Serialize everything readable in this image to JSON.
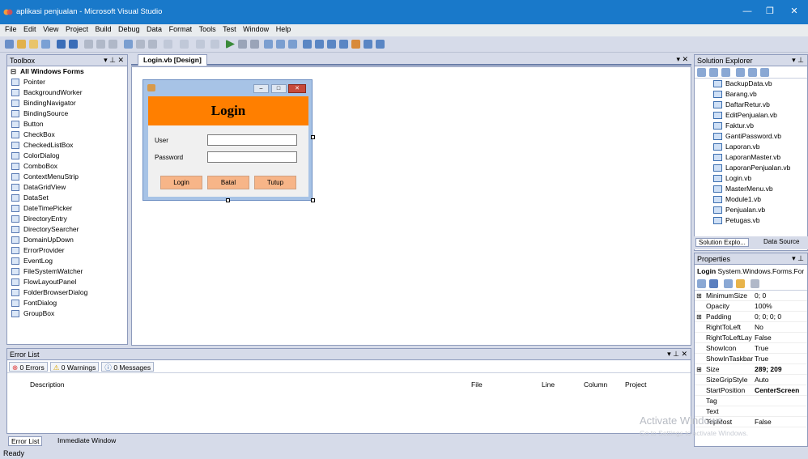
{
  "window": {
    "title": "aplikasi penjualan - Microsoft Visual Studio"
  },
  "menu": [
    "File",
    "Edit",
    "View",
    "Project",
    "Build",
    "Debug",
    "Data",
    "Format",
    "Tools",
    "Test",
    "Window",
    "Help"
  ],
  "toolbox": {
    "title": "Toolbox",
    "category": "All Windows Forms",
    "items": [
      "Pointer",
      "BackgroundWorker",
      "BindingNavigator",
      "BindingSource",
      "Button",
      "CheckBox",
      "CheckedListBox",
      "ColorDialog",
      "ComboBox",
      "ContextMenuStrip",
      "DataGridView",
      "DataSet",
      "DateTimePicker",
      "DirectoryEntry",
      "DirectorySearcher",
      "DomainUpDown",
      "ErrorProvider",
      "EventLog",
      "FileSystemWatcher",
      "FlowLayoutPanel",
      "FolderBrowserDialog",
      "FontDialog",
      "GroupBox"
    ]
  },
  "designer": {
    "tab": "Login.vb [Design]",
    "form": {
      "header": "Login",
      "user_label": "User",
      "password_label": "Password",
      "buttons": [
        "Login",
        "Batal",
        "Tutup"
      ]
    }
  },
  "solution_explorer": {
    "title": "Solution Explorer",
    "files": [
      "BackupData.vb",
      "Barang.vb",
      "DaftarRetur.vb",
      "EditPenjualan.vb",
      "Faktur.vb",
      "GantiPassword.vb",
      "Laporan.vb",
      "LaporanMaster.vb",
      "LaporanPenjualan.vb",
      "Login.vb",
      "MasterMenu.vb",
      "Module1.vb",
      "Penjualan.vb",
      "Petugas.vb"
    ],
    "tabs": [
      "Solution Explo...",
      "Data Source"
    ]
  },
  "properties": {
    "title": "Properties",
    "object": "Login",
    "object_type": "System.Windows.Forms.For",
    "rows": [
      {
        "name": "MinimumSize",
        "value": "0; 0",
        "expand": "⊞"
      },
      {
        "name": "Opacity",
        "value": "100%",
        "expand": ""
      },
      {
        "name": "Padding",
        "value": "0; 0; 0; 0",
        "expand": "⊞"
      },
      {
        "name": "RightToLeft",
        "value": "No",
        "expand": ""
      },
      {
        "name": "RightToLeftLay",
        "value": "False",
        "expand": ""
      },
      {
        "name": "ShowIcon",
        "value": "True",
        "expand": ""
      },
      {
        "name": "ShowInTaskbar",
        "value": "True",
        "expand": ""
      },
      {
        "name": "Size",
        "value": "289; 209",
        "expand": "⊞",
        "bold": true
      },
      {
        "name": "SizeGripStyle",
        "value": "Auto",
        "expand": ""
      },
      {
        "name": "StartPosition",
        "value": "CenterScreen",
        "expand": "",
        "bold": true
      },
      {
        "name": "Tag",
        "value": "",
        "expand": ""
      },
      {
        "name": "Text",
        "value": "",
        "expand": ""
      },
      {
        "name": "TopMost",
        "value": "False",
        "expand": ""
      }
    ]
  },
  "error_list": {
    "title": "Error List",
    "errors": "0 Errors",
    "warnings": "0 Warnings",
    "messages": "0 Messages",
    "columns": [
      "Description",
      "File",
      "Line",
      "Column",
      "Project"
    ]
  },
  "bottom_tabs": [
    "Error List",
    "Immediate Window"
  ],
  "status": "Ready",
  "watermark": {
    "line1": "Activate Windows",
    "line2": "Go to Settings to activate Windows."
  }
}
